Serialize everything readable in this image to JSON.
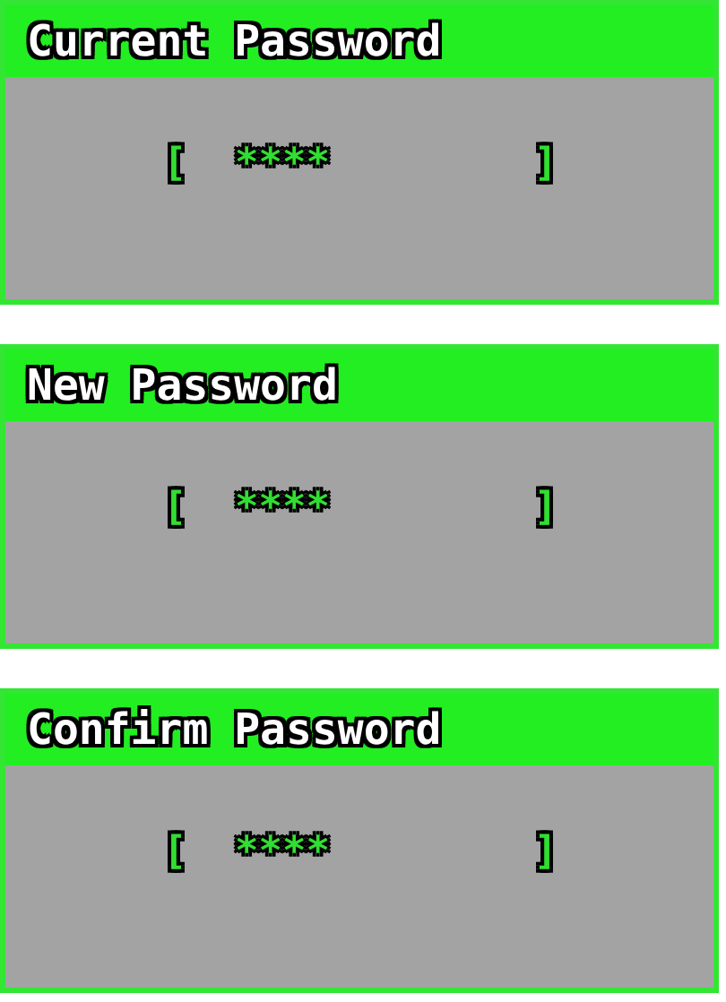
{
  "panels": [
    {
      "title": "Current Password",
      "field": {
        "open": "[",
        "value": "****",
        "close": "]"
      }
    },
    {
      "title": "New Password",
      "field": {
        "open": "[",
        "value": "****",
        "close": "]"
      }
    },
    {
      "title": "Confirm Password",
      "field": {
        "open": "[",
        "value": "****",
        "close": "]"
      }
    }
  ]
}
